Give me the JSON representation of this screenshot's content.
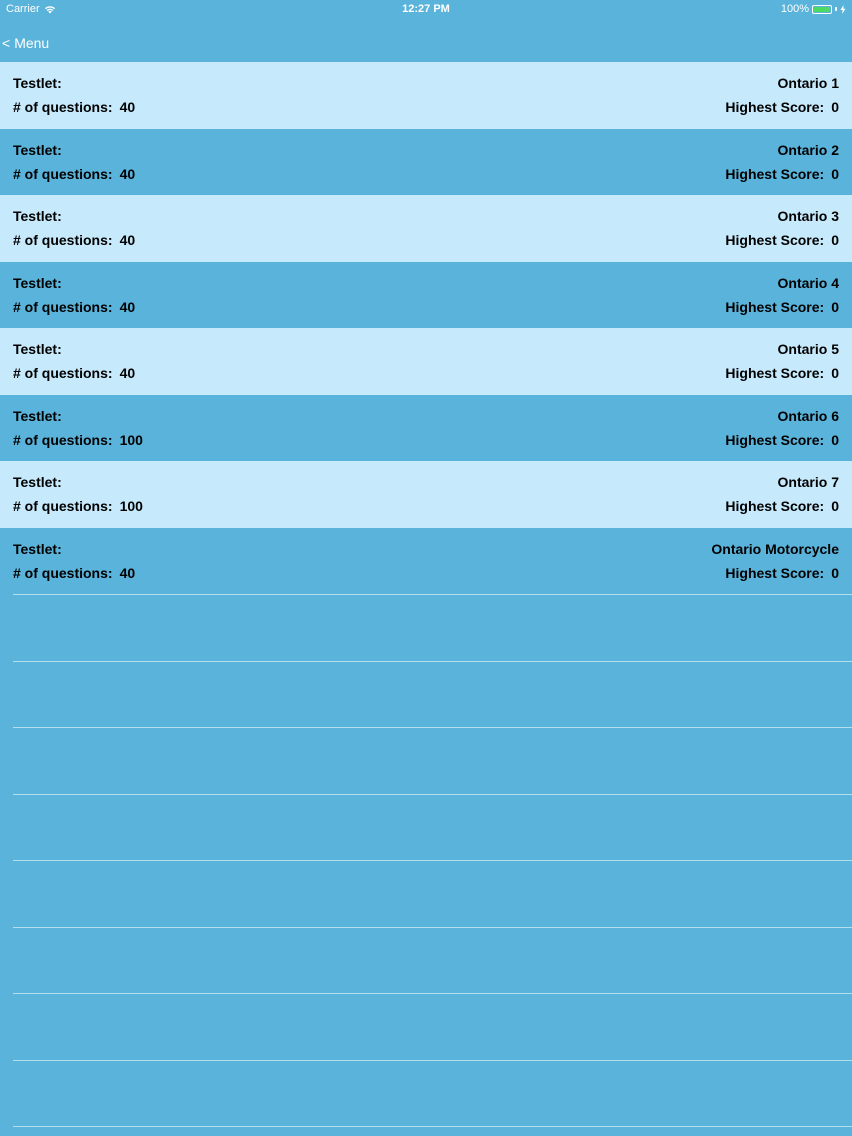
{
  "status_bar": {
    "carrier": "Carrier",
    "time": "12:27 PM",
    "battery": "100%"
  },
  "nav": {
    "back_chevron": "<",
    "back_label": "Menu"
  },
  "colors": {
    "background": "#5ab3da",
    "row_light": "#c6e9fb",
    "battery_green": "#4cd964"
  },
  "labels": {
    "testlet": "Testlet:",
    "questions": "# of questions:",
    "score": "Highest Score:"
  },
  "tests": [
    {
      "name": "Ontario 1",
      "questions": "40",
      "score": "0"
    },
    {
      "name": "Ontario 2",
      "questions": "40",
      "score": "0"
    },
    {
      "name": "Ontario 3",
      "questions": "40",
      "score": "0"
    },
    {
      "name": "Ontario 4",
      "questions": "40",
      "score": "0"
    },
    {
      "name": "Ontario 5",
      "questions": "40",
      "score": "0"
    },
    {
      "name": "Ontario 6",
      "questions": "100",
      "score": "0"
    },
    {
      "name": "Ontario 7",
      "questions": "100",
      "score": "0"
    },
    {
      "name": "Ontario Motorcycle",
      "questions": "40",
      "score": "0"
    }
  ]
}
